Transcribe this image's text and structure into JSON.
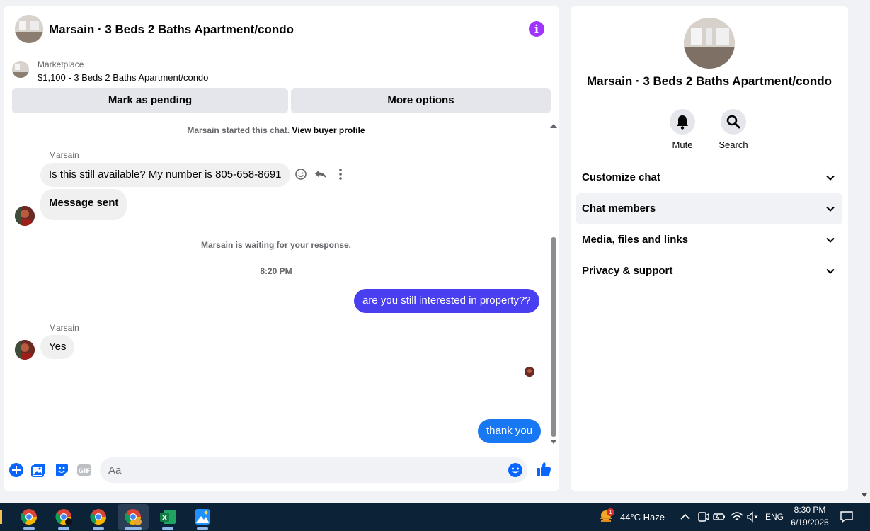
{
  "chat": {
    "title": "Marsain · 3 Beds 2 Baths Apartment/condo",
    "marketplace_label": "Marketplace",
    "listing": "$1,100 - 3 Beds 2 Baths Apartment/condo",
    "mark_pending_label": "Mark as pending",
    "more_options_label": "More options",
    "started_text": "Marsain started this chat.",
    "view_profile_link": "View buyer profile",
    "waiting_text": "Marsain is waiting for your response.",
    "timestamp": "8:20 PM",
    "messages": [
      {
        "sender": "Marsain",
        "text": "Is this still available? My number is 805-658-8691"
      },
      {
        "sender": "",
        "text": "Message sent"
      },
      {
        "sender": "me",
        "text": "are you  still interested in property??"
      },
      {
        "sender": "Marsain",
        "text": "Yes"
      },
      {
        "sender": "me",
        "text": "thank you"
      }
    ],
    "composer_placeholder": "Aa",
    "accent_color": "#4a3ff0",
    "outgoing_color_latest": "#1877f2"
  },
  "info": {
    "title": "Marsain · 3 Beds 2 Baths Apartment/condo",
    "mute_label": "Mute",
    "search_label": "Search",
    "sections": [
      "Customize chat",
      "Chat members",
      "Media, files and links",
      "Privacy & support"
    ]
  },
  "taskbar": {
    "weather": "44°C  Haze",
    "weather_badge": "1",
    "language": "ENG",
    "time": "8:30 PM",
    "date": "6/19/2025",
    "apps": [
      "chrome-icon",
      "chrome-icon",
      "chrome-icon",
      "chrome-icon",
      "excel-icon",
      "photos-icon"
    ]
  }
}
